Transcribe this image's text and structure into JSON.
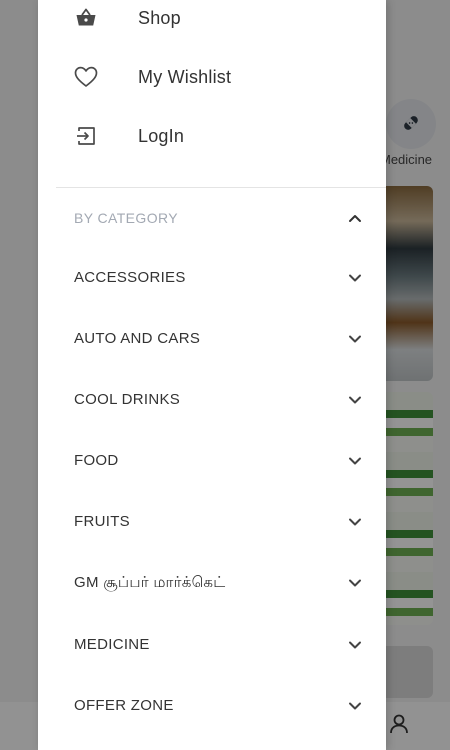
{
  "background": {
    "category_label": "Medicine"
  },
  "drawer": {
    "links": [
      {
        "label": "Shop",
        "icon": "basket-icon"
      },
      {
        "label": "My Wishlist",
        "icon": "heart-icon"
      },
      {
        "label": "LogIn",
        "icon": "login-icon"
      }
    ],
    "category_header": "BY CATEGORY",
    "categories": [
      "ACCESSORIES",
      "AUTO AND CARS",
      "COOL DRINKS",
      "FOOD",
      "FRUITS",
      "GM சூப்பர் மார்க்கெட்",
      "MEDICINE",
      "OFFER ZONE"
    ]
  },
  "colors": {
    "drawer_bg": "#ffffff",
    "text_primary": "#333333",
    "category_header": "#a3a9b3",
    "scrim": "rgba(0,0,0,0.42)"
  }
}
